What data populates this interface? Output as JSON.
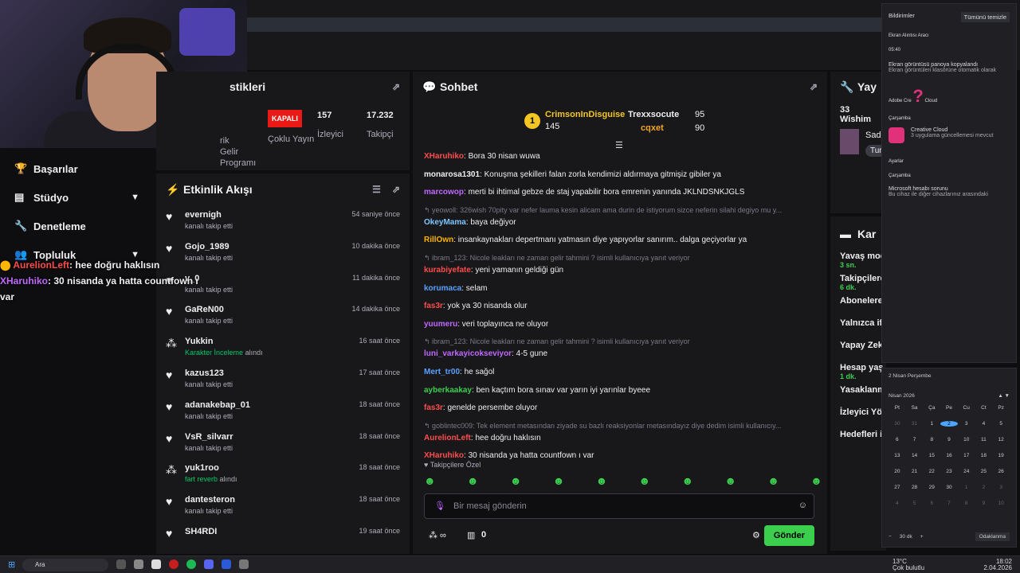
{
  "sidebar": {
    "items": [
      {
        "label": "Başarılar",
        "icon": "trophy-icon"
      },
      {
        "label": "Stüdyo",
        "icon": "studio-icon"
      },
      {
        "label": "Denetleme",
        "icon": "wrench-icon"
      },
      {
        "label": "Topluluk",
        "icon": "community-icon"
      }
    ]
  },
  "overlay": {
    "l1_user": "AurelionLeft",
    "l1_text": ": hee doğru haklısın",
    "l2_user": "XHaruhiko",
    "l2_text": ": 30 nisanda ya hatta countfown ı",
    "l3": "var"
  },
  "stats": {
    "title": "stikleri",
    "status": "KAPALI",
    "c1": "rik",
    "c1b": "Gelir Programı",
    "c2": "Çoklu Yayın",
    "c3v": "157",
    "c3": "İzleyici",
    "c4v": "17.232",
    "c4": "Takipçi"
  },
  "activity": {
    "title": "Etkinlik Akışı",
    "rows": [
      {
        "name": "evernigh",
        "sub": "kanalı takip etti",
        "time": "54 saniye önce"
      },
      {
        "name": "Gojo_1989",
        "sub": "kanalı takip etti",
        "time": "10 dakika önce"
      },
      {
        "name": "v_0",
        "sub": "kanalı takip etti",
        "time": "11 dakika önce"
      },
      {
        "name": "GaReN00",
        "sub": "kanalı takip etti",
        "time": "14 dakika önce"
      },
      {
        "name": "Yukkin",
        "sub_g": "Karakter İnceleme",
        "sub": "alındı",
        "time": "16 saat önce"
      },
      {
        "name": "kazus123",
        "sub": "kanalı takip etti",
        "time": "17 saat önce"
      },
      {
        "name": "adanakebap_01",
        "sub": "kanalı takip etti",
        "time": "18 saat önce"
      },
      {
        "name": "VsR_silvarr",
        "sub": "kanalı takip etti",
        "time": "18 saat önce"
      },
      {
        "name": "yuk1roo",
        "sub_g": "fart reverb",
        "sub": "alındı",
        "time": "18 saat önce"
      },
      {
        "name": "dantesteron",
        "sub": "kanalı takip etti",
        "time": "18 saat önce"
      },
      {
        "name": "SH4RDI",
        "sub": "",
        "time": "19 saat önce"
      }
    ]
  },
  "chat": {
    "title": "Sohbet",
    "p1": "CrimsonInDisguise",
    "p1v": "145",
    "p2": "Trexxsocute",
    "p2v": "95",
    "p3": "cqxet",
    "p3v": "90",
    "lines": [
      {
        "user": "XHaruhiko",
        "color": "#ff4c4c",
        "text": ": Bora 30 nisan wuwa"
      },
      {
        "user": "monarosa1301",
        "color": "#efeff1",
        "text": ": Konuşma şekilleri falan zorla kendimizi aldırmaya gitmişiz gibiler ya"
      },
      {
        "user": "marcowop",
        "color": "#c068ff",
        "text": ": merti bi ihtimal gebze de staj yapabilir bora emrenin yanında JKLNDSNKJGLS"
      },
      {
        "reply": "yeowoll: 326wish 70pity var nefer lauma kesin alicam ama durin de istiyorum sizce neferin silahi degiyo mu y...",
        "user": "OkeyMama",
        "color": "#7ec6ff",
        "text": ": baya değiyor"
      },
      {
        "user": "RillOwn",
        "color": "#ffb400",
        "text": ": insankaynakları depertmanı yatmasın diye yapıyorlar sanırım.. dalga geçiyorlar ya"
      },
      {
        "reply": "ibram_123: Nicole leakları ne zaman gelir tahmini ? isimli kullanıcıya yanıt veriyor",
        "user": "kurabiyefate",
        "color": "#ff4c4c",
        "text": ": yeni yamanın geldiği gün"
      },
      {
        "user": "korumaca",
        "color": "#5aa0ff",
        "text": ": selam"
      },
      {
        "user": "fas3r",
        "color": "#ff4c4c",
        "text": ": yok ya 30 nisanda olur"
      },
      {
        "user": "yuumeru",
        "color": "#c068ff",
        "text": ": veri toplayınca ne oluyor"
      },
      {
        "reply": "ibram_123: Nicole leakları ne zaman gelir tahmini ? isimli kullanıcıya yanıt veriyor",
        "user": "luni_varkayicokseviyor",
        "color": "#c068ff",
        "text": ": 4-5 gune"
      },
      {
        "user": "Mert_tr00",
        "color": "#5aa0ff",
        "text": ": he sağol"
      },
      {
        "user": "ayberkaakay",
        "color": "#3ccf4e",
        "text": ": ben kaçtım bora sınav var yarın iyi yarınlar byeee"
      },
      {
        "user": "fas3r",
        "color": "#ff4c4c",
        "text": ": genelde persembe oluyor"
      },
      {
        "reply": "goblintec009: Tek element metasından ziyade su bazlı reaksiyonlar metasındayız diye dedim isimli kullanıcıy...",
        "user": "AurelionLeft",
        "color": "#ff4c4c",
        "text": ": hee doğru haklısın"
      },
      {
        "user": "XHaruhiko",
        "color": "#ff4c4c",
        "text": ": 30 nisanda ya hatta countfown ı var"
      }
    ],
    "followers_only": "Takipçilere Özel",
    "placeholder": "Bir mesaj gönderin",
    "points": "0",
    "send": "Gönder"
  },
  "right": {
    "t1": "Yay",
    "t2": "33 Wishim",
    "t3": "Sade",
    "t4": "Tur",
    "t5": "Kar",
    "items": [
      {
        "l": "Yavaş mod",
        "v": "3 sn."
      },
      {
        "l": "Takipçilere",
        "v": "6 dk."
      },
      {
        "l": "Abonelere",
        "v": ""
      },
      {
        "l": "Yalnızca if",
        "v": ""
      },
      {
        "l": "Yapay Zek Denetimi",
        "v": ""
      },
      {
        "l": "Hesap yaş",
        "v": "1 dk."
      },
      {
        "l": "Yasaklanm",
        "v": ""
      },
      {
        "l": "İzleyici Yö",
        "v": ""
      },
      {
        "l": "Hedefleri i",
        "v": ""
      }
    ]
  },
  "notif": {
    "title": "Bildirimler",
    "clear": "Tümünü temizle",
    "app1": "Ekran Alıntısı Aracı",
    "time1": "05:40",
    "n1t": "Ekran görüntüsü panoya kopyalandı",
    "n1d": "Ekran görüntüleri klasörüne otomatik olarak",
    "app2": "Adobe Cre",
    "app2b": "Cloud",
    "grp": "Çarşamba",
    "cc": "Creative Cloud",
    "ccd": "3 uygulama güncellemesi mevcut",
    "app3": "Ayarlar",
    "grp2": "Çarşamba",
    "ms": "Microsoft hesabı sorunu",
    "msd": "Bu cihaz ile diğer cihazlarınız arasındaki"
  },
  "calendar": {
    "date": "2 Nisan Perşembe",
    "month": "Nisan 2026",
    "days": [
      "Pt",
      "Sa",
      "Ça",
      "Pe",
      "Cu",
      "Ct",
      "Pz"
    ],
    "cells": [
      "30",
      "31",
      "1",
      "2",
      "3",
      "4",
      "5",
      "6",
      "7",
      "8",
      "9",
      "10",
      "11",
      "12",
      "13",
      "14",
      "15",
      "16",
      "17",
      "18",
      "19",
      "20",
      "21",
      "22",
      "23",
      "24",
      "25",
      "26",
      "27",
      "28",
      "29",
      "30",
      "1",
      "2",
      "3",
      "4",
      "5",
      "6",
      "7",
      "8",
      "9",
      "10"
    ],
    "focus": "30 dk",
    "focus_btn": "Odaklanma"
  },
  "taskbar": {
    "search": "Ara",
    "weather": "13°C",
    "weather2": "Çok bulutlu",
    "time": "18:02",
    "date": "2.04.2026"
  }
}
